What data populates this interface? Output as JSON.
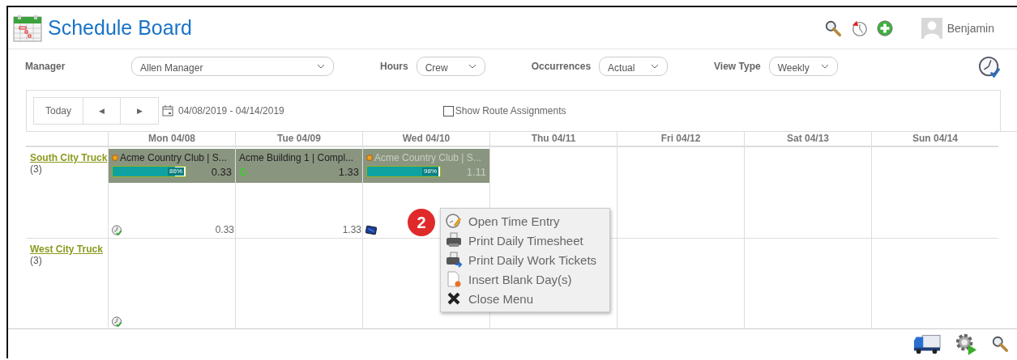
{
  "header": {
    "title": "Schedule Board",
    "user_name": "Benjamin"
  },
  "filters": [
    {
      "label": "Manager",
      "value": "Allen Manager",
      "kind": "wide"
    },
    {
      "label": "Hours",
      "value": "Crew",
      "kind": "narrow"
    },
    {
      "label": "Occurrences",
      "value": "Actual",
      "kind": "narrow"
    },
    {
      "label": "View Type",
      "value": "Weekly",
      "kind": "narrow"
    }
  ],
  "toolbar": {
    "today": "Today",
    "prev": "◀",
    "next": "▶",
    "date_range": "04/08/2019 - 04/14/2019",
    "route_checkbox": {
      "label": "Show Route Assignments",
      "checked": false
    }
  },
  "days": [
    "Mon 04/08",
    "Tue 04/09",
    "Wed 04/10",
    "Thu 04/11",
    "Fri 04/12",
    "Sat 04/13",
    "Sun 04/14"
  ],
  "resources": [
    {
      "name": "South City Truck",
      "count": "(3)",
      "cells": [
        {
          "kind": "filled",
          "jobs": [
            {
              "kind": "progress",
              "title": "Acme Country Club | S...",
              "dot": true,
              "dimmed": false,
              "level": 0.86,
              "percent": "86%",
              "hours": "0.33"
            }
          ],
          "footer": {
            "kind": "clock",
            "total": "0.33"
          }
        },
        {
          "kind": "filled",
          "jobs": [
            {
              "kind": "refresh",
              "title": "Acme Building 1 | Compl...",
              "dot": false,
              "dimmed": false,
              "hours": "1.33"
            }
          ],
          "footer": {
            "kind": "plain",
            "total": "1.33"
          }
        },
        {
          "kind": "filled",
          "jobs": [
            {
              "kind": "progress",
              "title": "Acme Country Club | S...",
              "dot": true,
              "dimmed": true,
              "level": 0.98,
              "percent": "98%",
              "hours": "1.11"
            }
          ],
          "footer": {
            "kind": "tablet"
          }
        },
        {
          "kind": "empty"
        },
        {
          "kind": "empty"
        },
        {
          "kind": "empty"
        },
        {
          "kind": "empty"
        }
      ]
    },
    {
      "name": "West City Truck",
      "count": "(3)",
      "cells": [
        {
          "kind": "filled",
          "footer": {
            "kind": "clock"
          }
        },
        {
          "kind": "empty"
        },
        {
          "kind": "empty"
        },
        {
          "kind": "empty"
        },
        {
          "kind": "empty"
        },
        {
          "kind": "empty"
        },
        {
          "kind": "empty"
        }
      ]
    }
  ],
  "badge": "2",
  "context_menu": [
    {
      "kind": "time-entry",
      "label": "Open Time Entry"
    },
    {
      "kind": "print",
      "label": "Print Daily Timesheet"
    },
    {
      "kind": "print-send",
      "label": "Print Daily Work Tickets"
    },
    {
      "kind": "insert",
      "label": "Insert Blank Day(s)"
    },
    {
      "kind": "close",
      "label": "Close Menu"
    }
  ]
}
